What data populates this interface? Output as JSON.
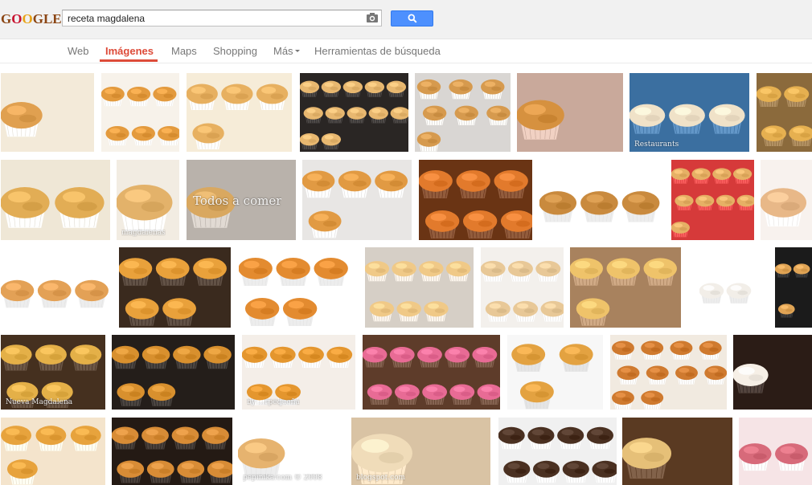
{
  "logo": {
    "letters": [
      "G",
      "O",
      "O",
      "G",
      "L",
      "E"
    ],
    "colors": [
      "#8b4513",
      "#c8102e",
      "#e8a317",
      "#8b4513",
      "#8b4513",
      "#8b4513"
    ]
  },
  "search": {
    "value": "receta magdalena",
    "camera_icon": "camera-icon",
    "button_icon": "search-icon"
  },
  "nav": {
    "items": [
      "Web",
      "Imágenes",
      "Maps",
      "Shopping",
      "Más",
      "Herramientas de búsqueda"
    ],
    "active_index": 1
  },
  "watermarks": {
    "r1_c7": "Restaurants",
    "r2_c2": "magdalenas",
    "r2_c3": "Todos a comer",
    "r4_c1": "Nueva Magdalena",
    "r4_c3": "by ...rpequeña",
    "r5_c3": "pepinika.com © 2008",
    "r5_c4": "blogspot.com"
  },
  "theme": {
    "accent": "#dd4b39",
    "button": "#4d90fe",
    "header_bg": "#f1f1f1"
  }
}
